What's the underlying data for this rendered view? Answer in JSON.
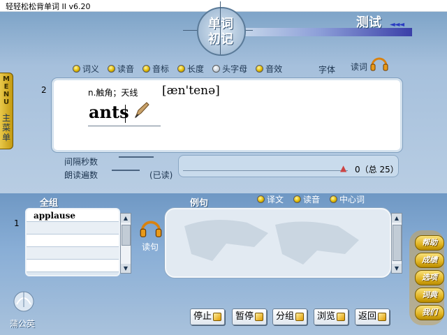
{
  "window": {
    "title": "轻轻松松背单词 II   v6.20"
  },
  "header": {
    "logo_line1": "单词",
    "logo_line2": "初记",
    "mode_title": "测试",
    "mode_arrows": "◄◄◄"
  },
  "options": [
    {
      "label": "词义",
      "checked": true
    },
    {
      "label": "读音",
      "checked": true
    },
    {
      "label": "音标",
      "checked": true
    },
    {
      "label": "长度",
      "checked": true
    },
    {
      "label": "头字母",
      "checked": false
    },
    {
      "label": "音效",
      "checked": true
    }
  ],
  "font_label": "字体",
  "read_word_label": "读词",
  "menu_tab": {
    "text": "MENU",
    "label": "主菜单"
  },
  "word_card": {
    "index": "2",
    "meaning": "n.触角；天线",
    "phonetic": "[æn'tenə]",
    "word": "ants"
  },
  "interval_label": "间隔秒数",
  "repeat_label": "朗读遍数",
  "already_read": "(已读)",
  "progress": {
    "text": "0（总 25）",
    "current": 0,
    "total": 25
  },
  "group_section": {
    "label": "全组",
    "index": "1",
    "items": [
      "applause",
      "",
      "",
      "",
      ""
    ]
  },
  "example_section": {
    "label": "例句",
    "options": [
      {
        "label": "译文",
        "checked": true
      },
      {
        "label": "读音",
        "checked": true
      },
      {
        "label": "中心词",
        "checked": true
      }
    ]
  },
  "read_sentence_label": "读句",
  "side_buttons": [
    "帮助",
    "成绩",
    "选项",
    "词典",
    "我们"
  ],
  "bottom_buttons": [
    "停止",
    "暂停",
    "分组",
    "浏览",
    "返回"
  ],
  "brand_label": "蒲公英",
  "colors": {
    "accent": "#e1b423",
    "panel": "#a9c2dc"
  }
}
